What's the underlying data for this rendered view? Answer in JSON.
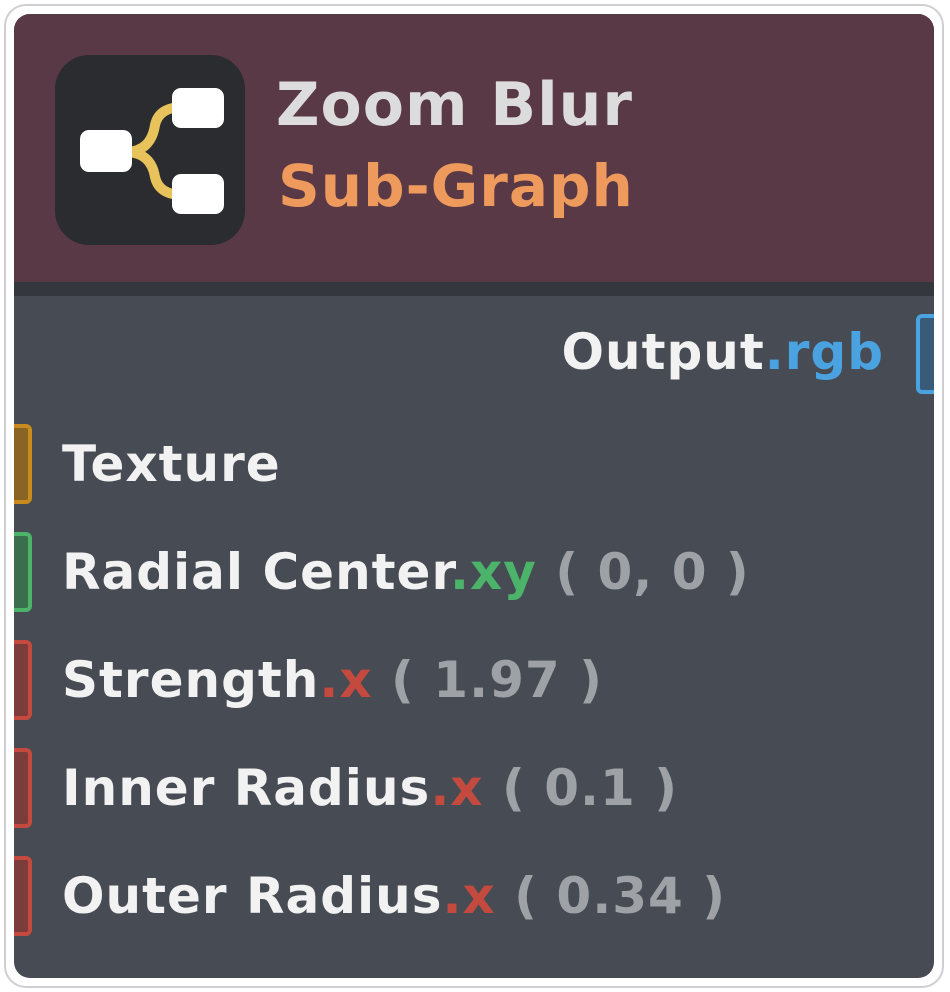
{
  "node": {
    "title": "Zoom Blur",
    "subtitle": "Sub-Graph",
    "icon": "subgraph-icon"
  },
  "output": {
    "name": "Output",
    "swizzle": ".rgb",
    "color": "#4aa3e0"
  },
  "inputs": [
    {
      "name": "Texture",
      "swizzle": "",
      "value": "",
      "color": "#c98a1e"
    },
    {
      "name": "Radial Center",
      "swizzle": ".xy",
      "value": "( 0, 0 )",
      "color": "#4cb36a"
    },
    {
      "name": "Strength",
      "swizzle": ".x",
      "value": "( 1.97 )",
      "color": "#c44a3f"
    },
    {
      "name": "Inner Radius",
      "swizzle": ".x",
      "value": "( 0.1 )",
      "color": "#c44a3f"
    },
    {
      "name": "Outer Radius",
      "swizzle": ".x",
      "value": "( 0.34 )",
      "color": "#c44a3f"
    }
  ],
  "colors": {
    "header": "#5a3947",
    "body": "#474b53",
    "title": "#dcdcdc",
    "subtitle": "#ee9a5c"
  }
}
